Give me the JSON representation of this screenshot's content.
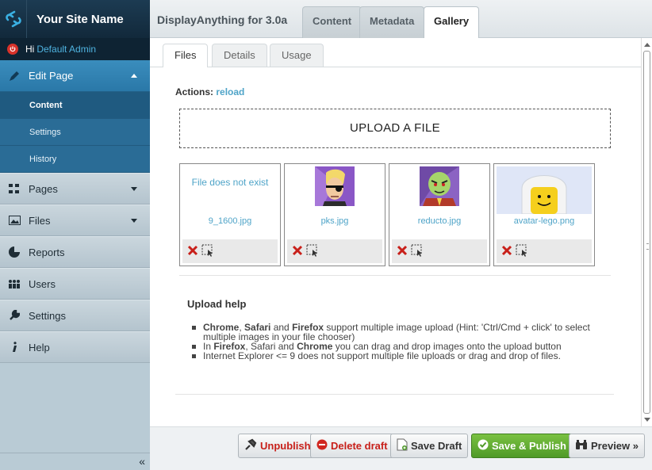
{
  "sidebar": {
    "site_name": "Your Site Name",
    "greeting": "Hi",
    "user_name": "Default Admin",
    "edit_page": "Edit Page",
    "edit_sub": [
      "Content",
      "Settings",
      "History"
    ],
    "items": [
      "Pages",
      "Files",
      "Reports",
      "Users",
      "Settings",
      "Help"
    ],
    "collapse": "«"
  },
  "header": {
    "title": "DisplayAnything for 3.0a",
    "tabs": [
      "Content",
      "Metadata",
      "Gallery"
    ],
    "active_tab": "Gallery"
  },
  "subtabs": [
    "Files",
    "Details",
    "Usage"
  ],
  "actions": {
    "label": "Actions:",
    "reload": "reload"
  },
  "upload": {
    "label": "UPLOAD A FILE"
  },
  "files": [
    {
      "name": "9_1600.jpg",
      "message": "File does not exist"
    },
    {
      "name": "pks.jpg",
      "message": ""
    },
    {
      "name": "reducto.jpg",
      "message": ""
    },
    {
      "name": "avatar-lego.png",
      "message": ""
    }
  ],
  "help": {
    "title": "Upload help",
    "line1_b1": "Chrome",
    "line1_t1": ", ",
    "line1_b2": "Safari",
    "line1_t2": " and ",
    "line1_b3": "Firefox",
    "line1_t3": " support multiple image upload (Hint: 'Ctrl/Cmd + click' to select multiple images in your file chooser)",
    "line2_t0": "In ",
    "line2_b1": "Firefox",
    "line2_t1": ", Safari and ",
    "line2_b2": "Chrome",
    "line2_t2": " you can drag and drop images onto the upload button",
    "line3": "Internet Explorer <= 9 does not support multiple file uploads or drag and drop of files."
  },
  "footer": {
    "unpublish": "Unpublish",
    "delete_draft": "Delete draft",
    "save_draft": "Save Draft",
    "save_publish": "Save & Publish",
    "preview": "Preview »"
  },
  "colors": {
    "accent": "#2a78a8",
    "link": "#4fa4c8",
    "publish": "#5fa834",
    "danger": "#c8201a"
  }
}
